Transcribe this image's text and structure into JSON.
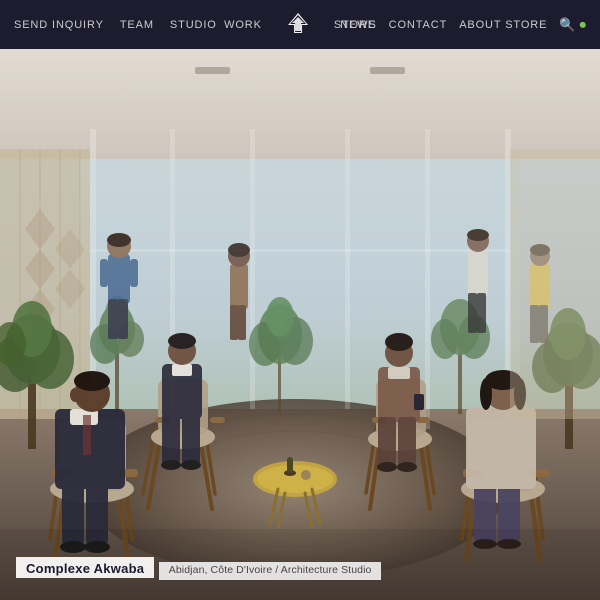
{
  "navbar": {
    "bg_color": "#1c1c2e",
    "left_links": [
      {
        "label": "SEND INQUIRY",
        "id": "send-inquiry"
      },
      {
        "label": "TEAM",
        "id": "team"
      },
      {
        "label": "STUDIO",
        "id": "studio"
      }
    ],
    "center_links": [
      {
        "label": "WORK",
        "id": "work"
      },
      {
        "label": "STORE",
        "id": "store"
      }
    ],
    "right_links": [
      {
        "label": "NEWS",
        "id": "news"
      },
      {
        "label": "CONTACT",
        "id": "contact"
      },
      {
        "label": "ABOUT STORE",
        "id": "about-store"
      }
    ],
    "logo_alt": "Crown/House logo"
  },
  "hero": {
    "image_alt": "Interior architectural rendering of modern office lobby with people sitting in chairs",
    "caption": {
      "title": "Complexe Akwaba",
      "subtitle": "Abidjan, Côte D'Ivoire / Architecture Studio"
    }
  },
  "icons": {
    "search": "🔍",
    "power": "⏻"
  }
}
